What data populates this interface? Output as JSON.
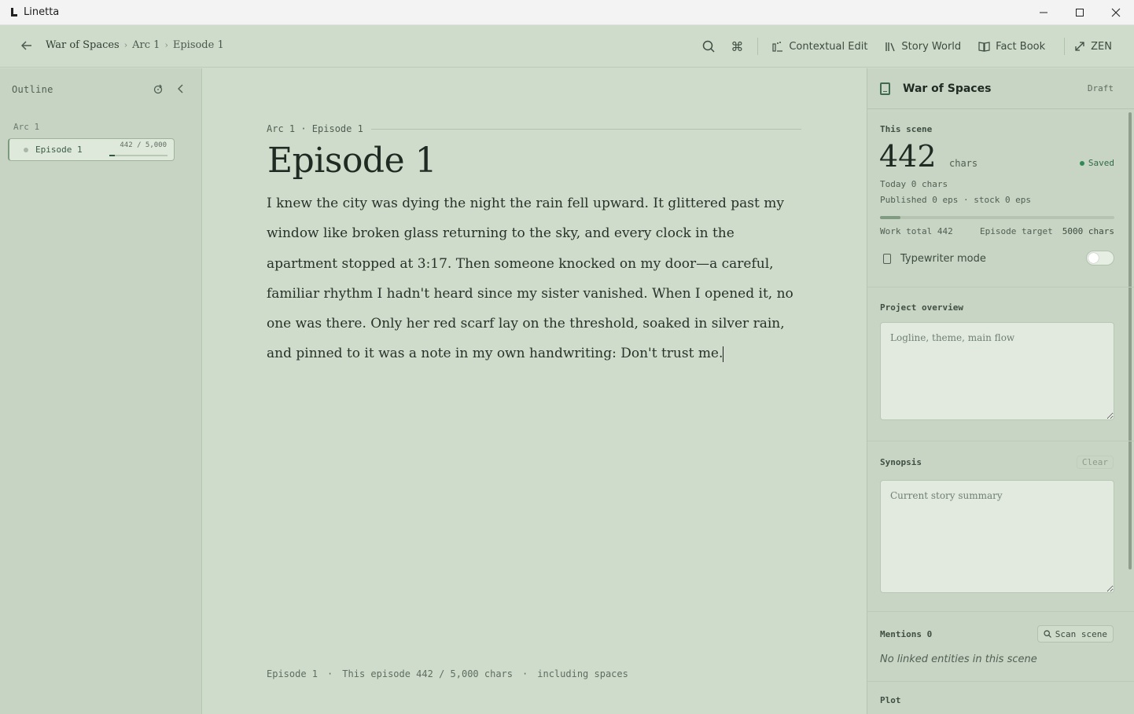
{
  "window": {
    "app_name": "Linetta",
    "controls": {
      "minimize": "—",
      "maximize": "☐",
      "close": "✕"
    }
  },
  "header": {
    "breadcrumb": [
      "War of Spaces",
      "Arc 1",
      "Episode 1"
    ],
    "breadcrumb_sep": "›",
    "toolbar": {
      "contextual_edit": "Contextual Edit",
      "story_world": "Story World",
      "fact_book": "Fact Book",
      "zen": "ZEN"
    }
  },
  "sidebar": {
    "title": "Outline",
    "arc_label": "Arc 1",
    "episodes": [
      {
        "label": "Episode 1",
        "count": "442 / 5,000",
        "progress": 0.0884
      }
    ]
  },
  "editor": {
    "crumb": "Arc 1 · Episode 1",
    "title": "Episode 1",
    "body": "I knew the city was dying the night the rain fell upward. It glittered past my window like broken glass returning to the sky, and every clock in the apartment stopped at 3:17. Then someone knocked on my door—a careful, familiar rhythm I hadn't heard since my sister vanished. When I opened it, no one was there. Only her red scarf lay on the threshold, soaked in silver rain, and pinned to it was a note in my own handwriting: Don't trust me.",
    "footer": {
      "episode": "Episode 1",
      "dot": "·",
      "count": "This episode 442 / 5,000 chars",
      "note": "including spaces"
    }
  },
  "panel": {
    "project_name": "War of Spaces",
    "status": "Draft",
    "this_scene": {
      "label": "This scene",
      "count": "442",
      "unit": "chars",
      "saved": "Saved",
      "today": "Today 0 chars",
      "published": "Published 0 eps · stock 0 eps",
      "progress": 0.0884,
      "work_total": "Work total 442",
      "episode_target_label": "Episode target",
      "episode_target_value": "5000 chars",
      "typewriter_mode": "Typewriter mode",
      "typewriter_on": false
    },
    "project_overview": {
      "label": "Project overview",
      "placeholder": "Logline, theme, main flow"
    },
    "synopsis": {
      "label": "Synopsis",
      "clear": "Clear",
      "placeholder": "Current story summary"
    },
    "mentions": {
      "label": "Mentions 0",
      "scan": "Scan scene",
      "empty": "No linked entities in this scene"
    },
    "plot": {
      "label": "Plot"
    }
  },
  "colors": {
    "background": "#cfdccb",
    "sidebar": "#c7d4c3",
    "accent": "#2f5a3d",
    "saved": "#2f8a55"
  }
}
